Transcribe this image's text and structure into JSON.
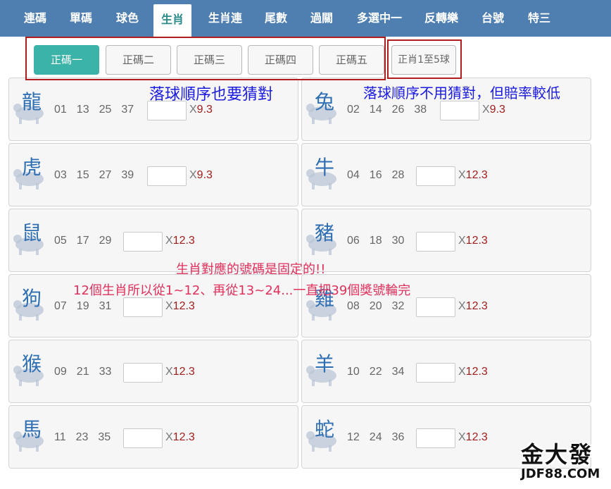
{
  "nav": {
    "items": [
      "連碼",
      "單碼",
      "球色",
      "生肖",
      "生肖連",
      "尾數",
      "過關",
      "多選中一",
      "反轉樂",
      "台號",
      "特三"
    ],
    "active": "生肖"
  },
  "subtabs": {
    "items": [
      "正碼一",
      "正碼二",
      "正碼三",
      "正碼四",
      "正碼五"
    ],
    "active": "正碼一",
    "all_label": "正肖1至5球"
  },
  "annotations": {
    "left": "落球順序也要猜對",
    "right": "落球順序不用猜對，但賠率較低",
    "middle1": "生肖對應的號碼是固定的!!",
    "middle2": "12個生肖所以從1~12、再從13~24...一直把39個獎號輪完"
  },
  "odds_prefix": "X",
  "zodiac": [
    {
      "name": "龍",
      "numbers": [
        "01",
        "13",
        "25",
        "37"
      ],
      "odds": "9.3",
      "icon": "dragon-icon"
    },
    {
      "name": "兔",
      "numbers": [
        "02",
        "14",
        "26",
        "38"
      ],
      "odds": "9.3",
      "icon": "rabbit-icon"
    },
    {
      "name": "虎",
      "numbers": [
        "03",
        "15",
        "27",
        "39"
      ],
      "odds": "9.3",
      "icon": "tiger-icon"
    },
    {
      "name": "牛",
      "numbers": [
        "04",
        "16",
        "28"
      ],
      "odds": "12.3",
      "icon": "ox-icon"
    },
    {
      "name": "鼠",
      "numbers": [
        "05",
        "17",
        "29"
      ],
      "odds": "12.3",
      "icon": "rat-icon"
    },
    {
      "name": "豬",
      "numbers": [
        "06",
        "18",
        "30"
      ],
      "odds": "12.3",
      "icon": "pig-icon"
    },
    {
      "name": "狗",
      "numbers": [
        "07",
        "19",
        "31"
      ],
      "odds": "12.3",
      "icon": "dog-icon"
    },
    {
      "name": "雞",
      "numbers": [
        "08",
        "20",
        "32"
      ],
      "odds": "12.3",
      "icon": "rooster-icon"
    },
    {
      "name": "猴",
      "numbers": [
        "09",
        "21",
        "33"
      ],
      "odds": "12.3",
      "icon": "monkey-icon"
    },
    {
      "name": "羊",
      "numbers": [
        "10",
        "22",
        "34"
      ],
      "odds": "12.3",
      "icon": "goat-icon"
    },
    {
      "name": "馬",
      "numbers": [
        "11",
        "23",
        "35"
      ],
      "odds": "12.3",
      "icon": "horse-icon"
    },
    {
      "name": "蛇",
      "numbers": [
        "12",
        "24",
        "36"
      ],
      "odds": "12.3",
      "icon": "snake-icon"
    }
  ],
  "watermark": {
    "line1": "金大發",
    "line2": "JDF88.COM"
  },
  "colors": {
    "nav_bg": "#4f7fb1",
    "active_tab": "#3cb3a8",
    "odds": "#a31c1c",
    "annotation_blue": "#1a1ae0",
    "annotation_red": "#e0305c",
    "highlight_box": "#b11c1c"
  }
}
